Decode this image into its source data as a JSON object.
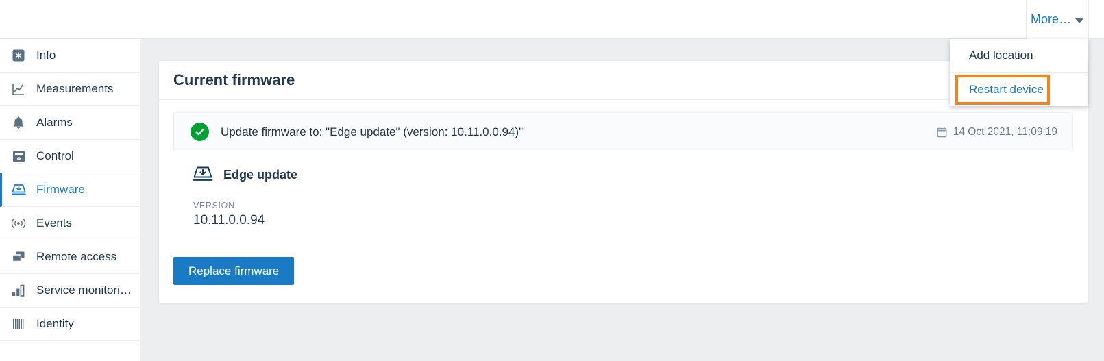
{
  "topbar": {
    "more_label": "More…",
    "caret_icon": "chevron-down-icon"
  },
  "dropdown": {
    "items": [
      {
        "label": "Add location",
        "style": "default",
        "name": "add-location"
      },
      {
        "label": "Restart device",
        "style": "link",
        "name": "restart-device",
        "highlighted": true
      }
    ],
    "highlight_color": "#f58220"
  },
  "sidebar": {
    "items": [
      {
        "label": "Info",
        "icon": "info-badge-icon",
        "active": false
      },
      {
        "label": "Measurements",
        "icon": "line-chart-icon",
        "active": false
      },
      {
        "label": "Alarms",
        "icon": "bell-icon",
        "active": false
      },
      {
        "label": "Control",
        "icon": "control-panel-icon",
        "active": false
      },
      {
        "label": "Firmware",
        "icon": "firmware-download-icon",
        "active": true
      },
      {
        "label": "Events",
        "icon": "broadcast-icon",
        "active": false
      },
      {
        "label": "Remote access",
        "icon": "remote-screens-icon",
        "active": false
      },
      {
        "label": "Service monitori…",
        "icon": "bar-chart-icon",
        "active": false
      },
      {
        "label": "Identity",
        "icon": "barcode-icon",
        "active": false
      }
    ]
  },
  "card": {
    "title": "Current firmware",
    "status": {
      "icon": "check-circle-icon",
      "text": "Update firmware to: \"Edge update\" (version: 10.11.0.0.94)\"",
      "date_icon": "calendar-icon",
      "date": "14 Oct 2021, 11:09:19"
    },
    "firmware": {
      "icon": "firmware-download-icon",
      "name": "Edge update",
      "version_label": "VERSION",
      "version_value": "10.11.0.0.94"
    },
    "replace_button": "Replace firmware"
  },
  "colors": {
    "accent_blue": "#1a7ac4",
    "success_green": "#00a033",
    "highlight_orange": "#f58220",
    "text_navy": "#21384e",
    "page_background": "#eceef0"
  }
}
